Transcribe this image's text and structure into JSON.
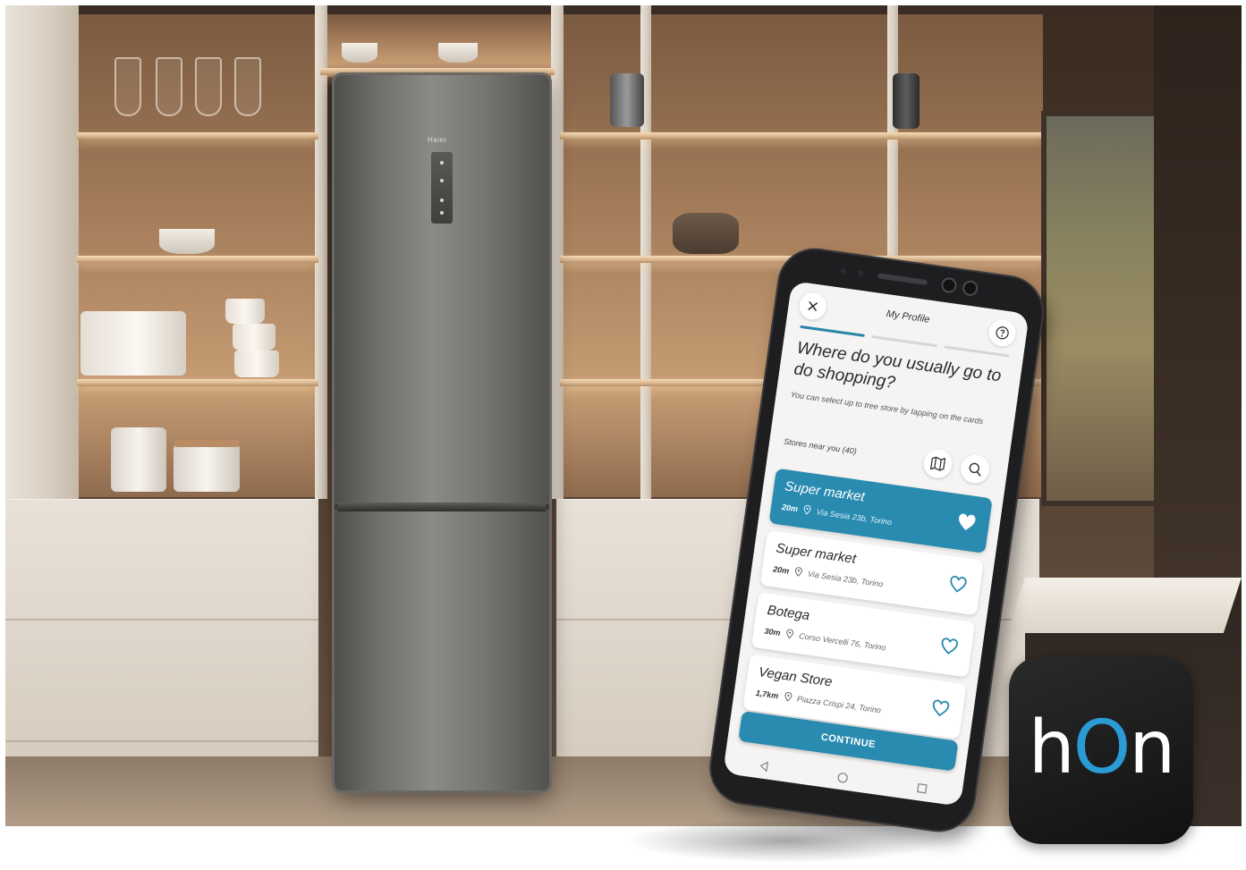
{
  "scene": {
    "fridge_brand": "Haier"
  },
  "app": {
    "header_title": "My Profile",
    "close_icon": "close-icon",
    "help_icon": "help-icon",
    "progress_steps": 3,
    "progress_active": 1,
    "question": "Where do you usually go to do shopping?",
    "hint": "You can select up to tree store by tapping on the cards",
    "stores_near_label": "Stores near you (40)",
    "map_icon": "map-icon",
    "search_icon": "search-icon",
    "stores": [
      {
        "name": "Super market",
        "distance": "20m",
        "address": "Via Sesia 23b, Torino",
        "selected": true
      },
      {
        "name": "Super market",
        "distance": "20m",
        "address": "Via Sesia 23b, Torino",
        "selected": false
      },
      {
        "name": "Botega",
        "distance": "30m",
        "address": "Corso Vercelli 76, Torino",
        "selected": false
      },
      {
        "name": "Vegan Store",
        "distance": "1,7km",
        "address": "Piazza Crispi 24, Torino",
        "selected": false
      }
    ],
    "continue_label": "CONTINUE",
    "colors": {
      "accent": "#2a8bb0",
      "screen_bg": "#f5f4f2"
    }
  },
  "badge": {
    "logo_text": "hOn",
    "logo_color_accent": "#2a9bd4"
  }
}
